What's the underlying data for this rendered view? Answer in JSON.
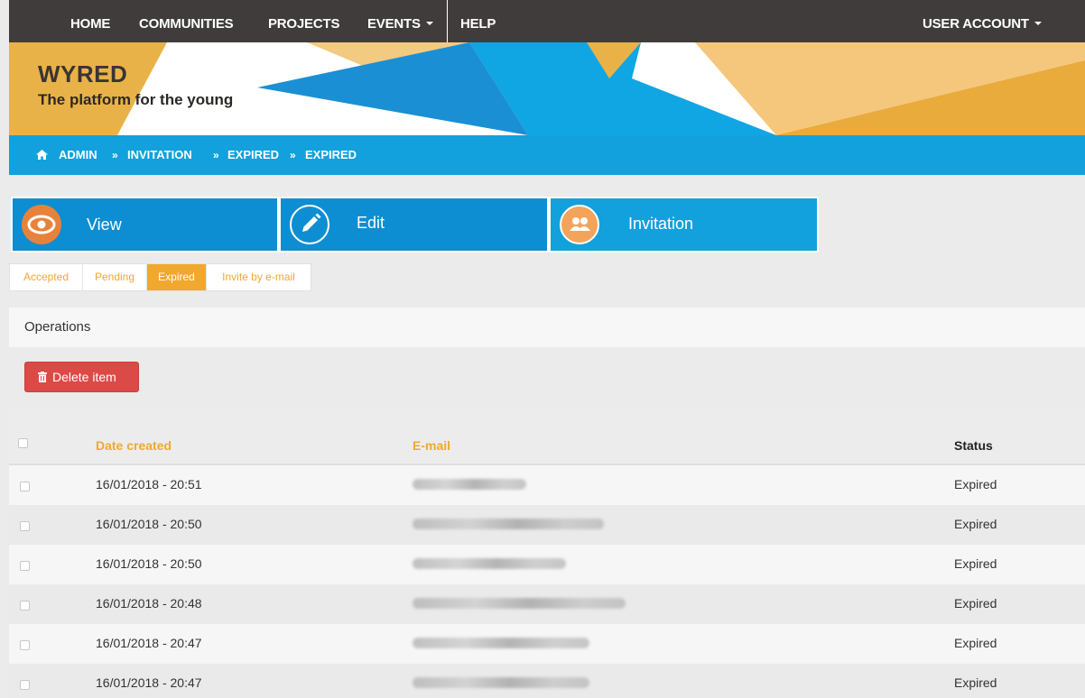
{
  "nav": {
    "items": [
      {
        "label": "HOME"
      },
      {
        "label": "COMMUNITIES"
      },
      {
        "label": "PROJECTS"
      },
      {
        "label": "EVENTS"
      },
      {
        "label": "HELP"
      }
    ],
    "user_account": "USER ACCOUNT"
  },
  "brand": {
    "title": "WYRED",
    "subtitle": "The platform for the young"
  },
  "breadcrumb": [
    "ADMIN",
    "INVITATION",
    "EXPIRED",
    "EXPIRED"
  ],
  "tiles": [
    {
      "label": "View",
      "icon": "eye-icon"
    },
    {
      "label": "Edit",
      "icon": "pencil-icon"
    },
    {
      "label": "Invitation",
      "icon": "people-icon"
    }
  ],
  "subtabs": [
    {
      "label": "Accepted"
    },
    {
      "label": "Pending"
    },
    {
      "label": "Expired",
      "active": true
    },
    {
      "label": "Invite by e-mail"
    }
  ],
  "operations": {
    "title": "Operations",
    "delete_label": "Delete item"
  },
  "table": {
    "headers": {
      "date": "Date created",
      "email": "E-mail",
      "status": "Status"
    },
    "rows": [
      {
        "date": "16/01/2018 - 20:51",
        "status": "Expired"
      },
      {
        "date": "16/01/2018 - 20:50",
        "status": "Expired"
      },
      {
        "date": "16/01/2018 - 20:50",
        "status": "Expired"
      },
      {
        "date": "16/01/2018 - 20:48",
        "status": "Expired"
      },
      {
        "date": "16/01/2018 - 20:47",
        "status": "Expired"
      },
      {
        "date": "16/01/2018 - 20:47",
        "status": "Expired"
      }
    ]
  },
  "colors": {
    "nav_bg": "#403c3c",
    "accent_blue": "#12a1dc",
    "tile_blue": "#0e8ed2",
    "accent_orange": "#f0a82e",
    "danger": "#dc4a47",
    "icon_orange": "#e8823a",
    "icon_peach": "#f4a45a"
  }
}
